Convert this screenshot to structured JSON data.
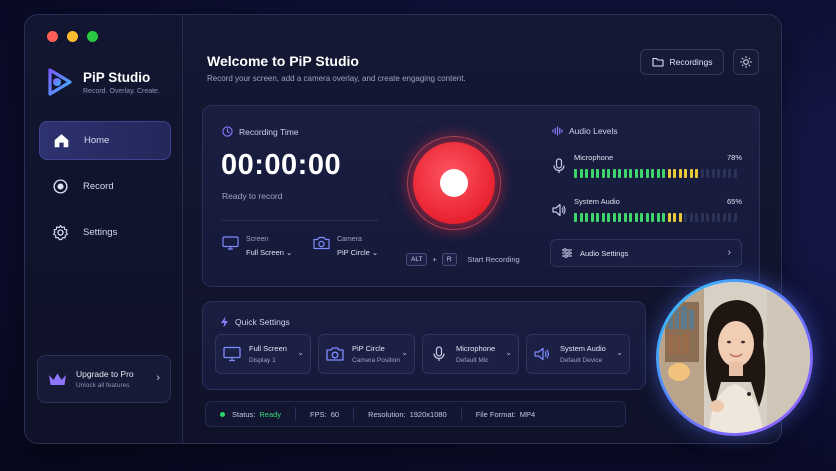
{
  "app": {
    "name": "PiP Studio",
    "tagline": "Record. Overlay. Create."
  },
  "sidebar": {
    "items": [
      {
        "label": "Home",
        "icon": "home-icon",
        "active": true
      },
      {
        "label": "Record",
        "icon": "record-icon",
        "active": false
      },
      {
        "label": "Settings",
        "icon": "gear-icon",
        "active": false
      }
    ],
    "upgrade": {
      "title": "Upgrade to Pro",
      "subtitle": "Unlock all features",
      "icon": "crown-icon"
    }
  },
  "header": {
    "title": "Welcome to PiP Studio",
    "subtitle": "Record your screen, add a camera overlay, and create engaging content.",
    "recordings_label": "Recordings"
  },
  "recording": {
    "title": "Recording Time",
    "time": "00:00:00",
    "status": "Ready to record",
    "screen": {
      "label": "Screen",
      "value": "Full Screen"
    },
    "camera": {
      "label": "Camera",
      "value": "PiP Circle"
    },
    "shortcut": {
      "key1": "ALT",
      "plus": "+",
      "key2": "R",
      "label": "Start Recording"
    }
  },
  "audio": {
    "title": "Audio Levels",
    "microphone": {
      "label": "Microphone",
      "level": "78%",
      "fraction": 0.78
    },
    "system": {
      "label": "System Audio",
      "level": "65%",
      "fraction": 0.65
    },
    "settings_label": "Audio Settings"
  },
  "quick_settings": {
    "title": "Quick Settings",
    "cards": [
      {
        "title": "Full Screen",
        "subtitle": "Display 1",
        "icon": "monitor-icon"
      },
      {
        "title": "PiP Circle",
        "subtitle": "Camera Position",
        "icon": "camera-icon"
      },
      {
        "title": "Microphone",
        "subtitle": "Default Mic",
        "icon": "microphone-icon"
      },
      {
        "title": "System Audio",
        "subtitle": "Default Device",
        "icon": "speaker-icon"
      }
    ]
  },
  "status_bar": {
    "status_label": "Status:",
    "status_value": "Ready",
    "fps_label": "FPS:",
    "fps_value": "60",
    "resolution_label": "Resolution:",
    "resolution_value": "1920x1080",
    "format_label": "File Format:",
    "format_value": "MP4"
  },
  "colors": {
    "accent": "#5b61e8",
    "record": "#e8222f",
    "ready": "#36d877",
    "meter_green": "#3fd66b",
    "meter_yellow": "#e9c93a"
  }
}
